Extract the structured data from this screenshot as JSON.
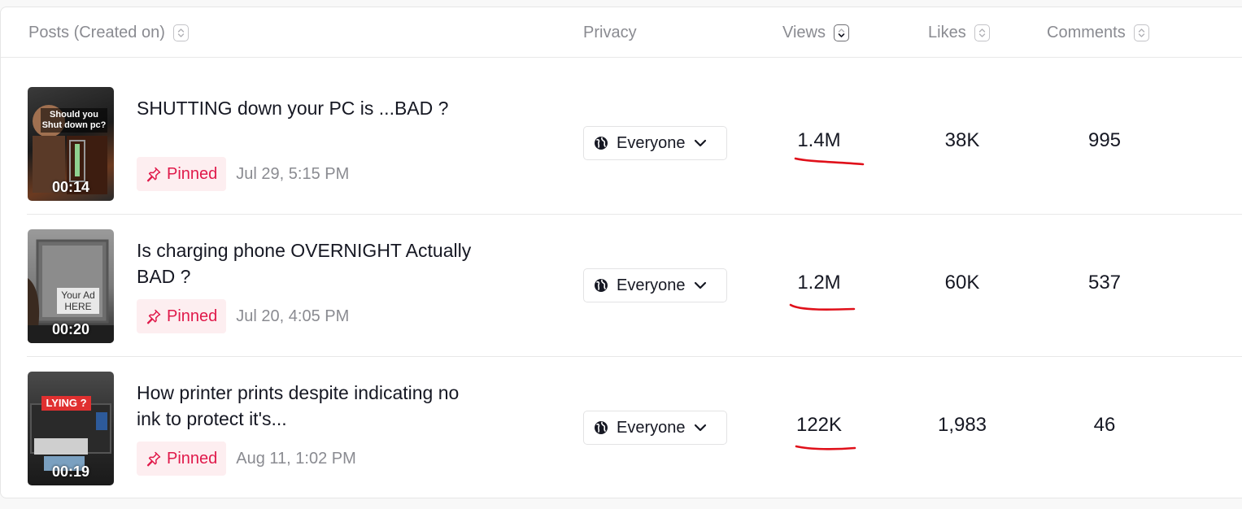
{
  "header": {
    "posts_label": "Posts (Created on)",
    "privacy_label": "Privacy",
    "views_label": "Views",
    "likes_label": "Likes",
    "comments_label": "Comments"
  },
  "colors": {
    "pinned_text": "#e0194a",
    "pinned_bg": "#fdeef0",
    "annotation_red": "#e0101a"
  },
  "rows": [
    {
      "thumbnail_text": "Should you Shut down pc?",
      "duration": "00:14",
      "title": "SHUTTING down your PC is ...BAD ?",
      "pinned_label": "Pinned",
      "date": "Jul 29, 5:15 PM",
      "privacy": "Everyone",
      "views": "1.4M",
      "likes": "38K",
      "comments": "995"
    },
    {
      "thumbnail_text": "Your Ad HERE",
      "duration": "00:20",
      "title": "Is charging phone OVERNIGHT Actually BAD ?",
      "pinned_label": "Pinned",
      "date": "Jul 20, 4:05 PM",
      "privacy": "Everyone",
      "views": "1.2M",
      "likes": "60K",
      "comments": "537"
    },
    {
      "thumbnail_text": "LYING ?",
      "duration": "00:19",
      "title": "How printer prints despite indicating no ink to protect it's...",
      "pinned_label": "Pinned",
      "date": "Aug 11, 1:02 PM",
      "privacy": "Everyone",
      "views": "122K",
      "likes": "1,983",
      "comments": "46"
    }
  ]
}
